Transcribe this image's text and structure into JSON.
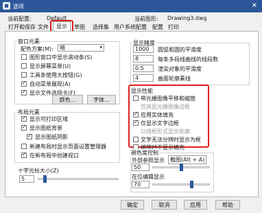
{
  "window": {
    "title": "选项",
    "close": "✕"
  },
  "profile": {
    "label": "当前配置:",
    "value": "Default",
    "drawing_label": "当前图形:",
    "drawing_value": "Drawing3.dwg"
  },
  "tabs": [
    "打开和保存",
    "文件",
    "显示",
    "草图",
    "选择集",
    "用户系统配置",
    "配置",
    "打印"
  ],
  "window_elements": {
    "heading": "窗口元素",
    "scheme_label": "配色方案(M):",
    "scheme_value": "暗",
    "checks": [
      {
        "label": "图形窗口中显示滚动条(S)",
        "checked": false
      },
      {
        "label": "显示屏幕菜单(U)",
        "checked": false
      },
      {
        "label": "工具条使用大按钮(G)",
        "checked": false
      },
      {
        "label": "自动菜单展现(A)",
        "checked": true
      },
      {
        "label": "显示文件选项卡(F)",
        "checked": true
      }
    ],
    "color_button": "颜色...",
    "font_button": "字体..."
  },
  "layout_elements": {
    "heading": "布局元素",
    "checks": [
      {
        "label": "显示可打印区域",
        "checked": true
      },
      {
        "label": "显示图纸背景",
        "checked": true
      },
      {
        "label": "显示图纸阴影",
        "checked": true
      },
      {
        "label": "新建布局时显示页面设置管理器",
        "checked": false
      },
      {
        "label": "在新布局中创建视口",
        "checked": true
      }
    ]
  },
  "crosshair": {
    "label": "十字光标大小(Z)",
    "value": "5"
  },
  "precision": {
    "heading": "显示精度",
    "rows": [
      {
        "value": "1000",
        "label": "圆弧和圆的平滑度"
      },
      {
        "value": "8",
        "label": "每条多段线曲线的线段数"
      },
      {
        "value": "0.5",
        "label": "渲染对象的平滑度"
      },
      {
        "value": "4",
        "label": "曲面轮廓素线"
      }
    ]
  },
  "performance": {
    "heading": "显示性能",
    "checks": [
      {
        "label": "带光栅图像平移和缩放",
        "checked": false,
        "disabled": false
      },
      {
        "label": "仅亮显光栅图像边框",
        "checked": false,
        "disabled": true
      },
      {
        "label": "应用实体填充",
        "checked": true,
        "disabled": false
      },
      {
        "label": "仅显示文字边框",
        "checked": true,
        "disabled": false
      },
      {
        "label": "以线框形式显示轮廓",
        "checked": false,
        "disabled": true
      },
      {
        "label": "文字无法分辨时显示为框",
        "checked": false,
        "disabled": false
      },
      {
        "label": "缩放时不显示填充",
        "checked": false,
        "disabled": false
      }
    ]
  },
  "fade": {
    "heading": "褪色度控制",
    "xref_label": "外部参照显示",
    "xref_tooltip": "截图(Alt + A)",
    "xref_value": "50",
    "inplace_label": "在位编辑显示",
    "inplace_value": "70",
    "xref_level": 0.5,
    "inplace_level": 0.7
  },
  "footer": {
    "ok": "确定",
    "cancel": "取消",
    "apply": "应用",
    "help": "帮助"
  },
  "colors": {
    "titlebar": "#2b579a",
    "highlight": "#e02020"
  }
}
